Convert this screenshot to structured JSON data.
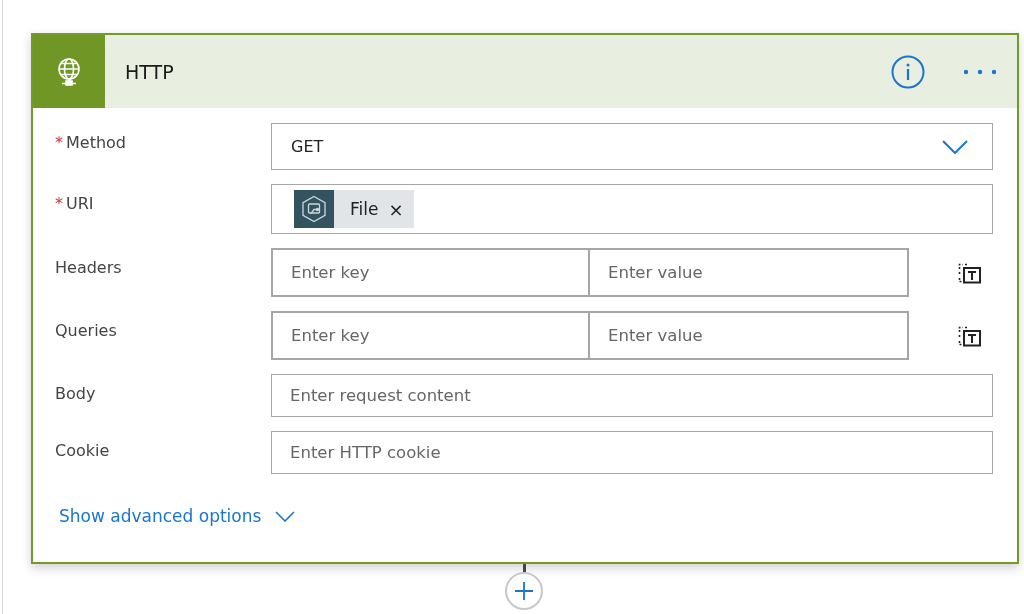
{
  "card": {
    "title": "HTTP"
  },
  "fields": [
    {
      "kind": "dropdown",
      "label": "Method",
      "required": true,
      "value": "GET"
    },
    {
      "kind": "token",
      "label": "URI",
      "required": true,
      "token": "File",
      "remove": "×"
    },
    {
      "kind": "keyvalue",
      "label": "Headers",
      "required": false,
      "key_placeholder": "Enter key",
      "value_placeholder": "Enter value"
    },
    {
      "kind": "keyvalue",
      "label": "Queries",
      "required": false,
      "key_placeholder": "Enter key",
      "value_placeholder": "Enter value"
    },
    {
      "kind": "text",
      "label": "Body",
      "required": false,
      "placeholder": "Enter request content"
    },
    {
      "kind": "text",
      "label": "Cookie",
      "required": false,
      "placeholder": "Enter HTTP cookie"
    }
  ],
  "advanced": {
    "label": "Show advanced options"
  },
  "required_mark": "*"
}
